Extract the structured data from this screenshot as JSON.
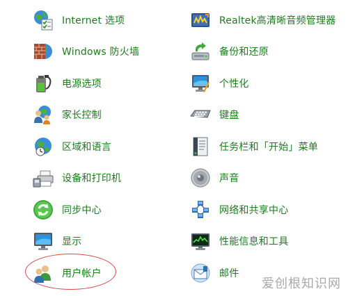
{
  "left_items": [
    {
      "label": "Internet 选项",
      "icon": "internet-options-icon"
    },
    {
      "label": "Windows 防火墙",
      "icon": "firewall-icon"
    },
    {
      "label": "电源选项",
      "icon": "power-options-icon"
    },
    {
      "label": "家长控制",
      "icon": "parental-controls-icon"
    },
    {
      "label": "区域和语言",
      "icon": "region-language-icon"
    },
    {
      "label": "设备和打印机",
      "icon": "devices-printers-icon"
    },
    {
      "label": "同步中心",
      "icon": "sync-center-icon"
    },
    {
      "label": "显示",
      "icon": "display-icon"
    },
    {
      "label": "用户帐户",
      "icon": "user-accounts-icon"
    }
  ],
  "right_items": [
    {
      "label": "Realtek高清晰音频管理器",
      "icon": "realtek-audio-icon"
    },
    {
      "label": "备份和还原",
      "icon": "backup-restore-icon"
    },
    {
      "label": "个性化",
      "icon": "personalization-icon"
    },
    {
      "label": "键盘",
      "icon": "keyboard-icon"
    },
    {
      "label": "任务栏和「开始」菜单",
      "icon": "taskbar-start-menu-icon"
    },
    {
      "label": "声音",
      "icon": "sound-icon"
    },
    {
      "label": "网络和共享中心",
      "icon": "network-sharing-icon"
    },
    {
      "label": "性能信息和工具",
      "icon": "performance-tools-icon"
    },
    {
      "label": "邮件",
      "icon": "mail-icon"
    }
  ],
  "watermark": "爱创根知识网",
  "colors": {
    "link": "#1e7a1e",
    "highlight": "#d94a4a",
    "background": "#ffffff"
  }
}
